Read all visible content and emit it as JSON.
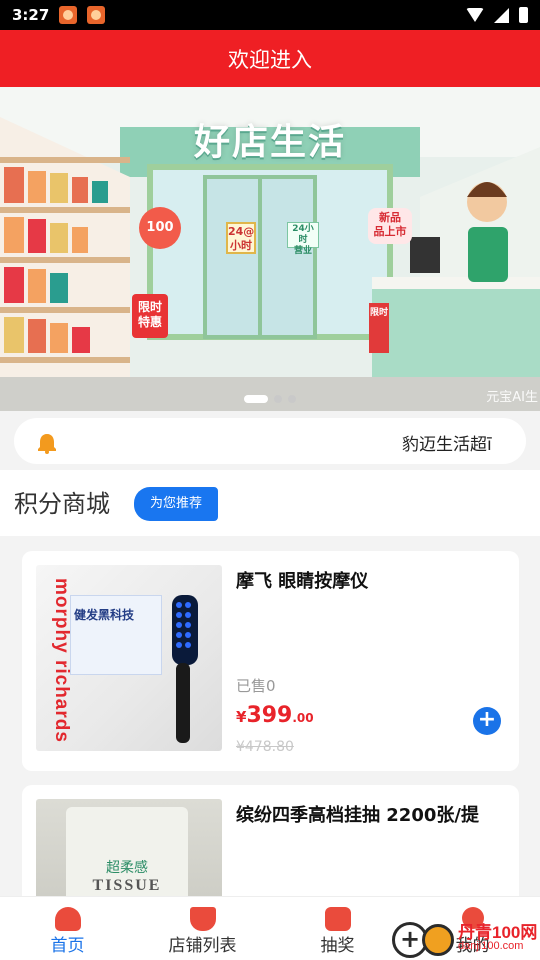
{
  "status_bar": {
    "time": "3:27"
  },
  "header": {
    "title": "欢迎进入"
  },
  "banner": {
    "headline": "好店生活",
    "tag_100": "100",
    "tag_24h": "24@\n小时",
    "tag_24_open": "24小时\n营业",
    "tag_new": "新品\n品上市",
    "tag_limit": "限时\n特惠",
    "tag_side": "限时",
    "watermark": "元宝AI生",
    "page_count": 3,
    "active_page": 1
  },
  "notice": {
    "text": "豹迈生活超ī"
  },
  "section": {
    "title": "积分商城",
    "recommend_label": "为您推荐"
  },
  "products": [
    {
      "name": "摩飞 眼睛按摩仪",
      "sold": "已售0",
      "currency": "¥",
      "price_int": "399",
      "price_dec": ".00",
      "original_price": "¥478.80",
      "add_label": "+",
      "thumb_brand": "morphy richards",
      "thumb_box_title": "健发黑科技"
    },
    {
      "name": "缤纷四季高档挂抽 2200张/提",
      "thumb_sub": "超柔感",
      "thumb_brand": "TISSUE"
    }
  ],
  "bottom_nav": [
    {
      "label": "首页",
      "icon": "home-icon",
      "active": true
    },
    {
      "label": "店铺列表",
      "icon": "shop-icon",
      "active": false
    },
    {
      "label": "抽奖",
      "icon": "lottery-icon",
      "active": false
    },
    {
      "label": "我的",
      "icon": "user-icon",
      "active": false
    }
  ],
  "watermark": {
    "text": "丹青100网",
    "url": "danji100.com"
  },
  "colors": {
    "brand_red": "#ef1f24",
    "accent_blue": "#1a73e8",
    "price_red": "#e8232a"
  }
}
